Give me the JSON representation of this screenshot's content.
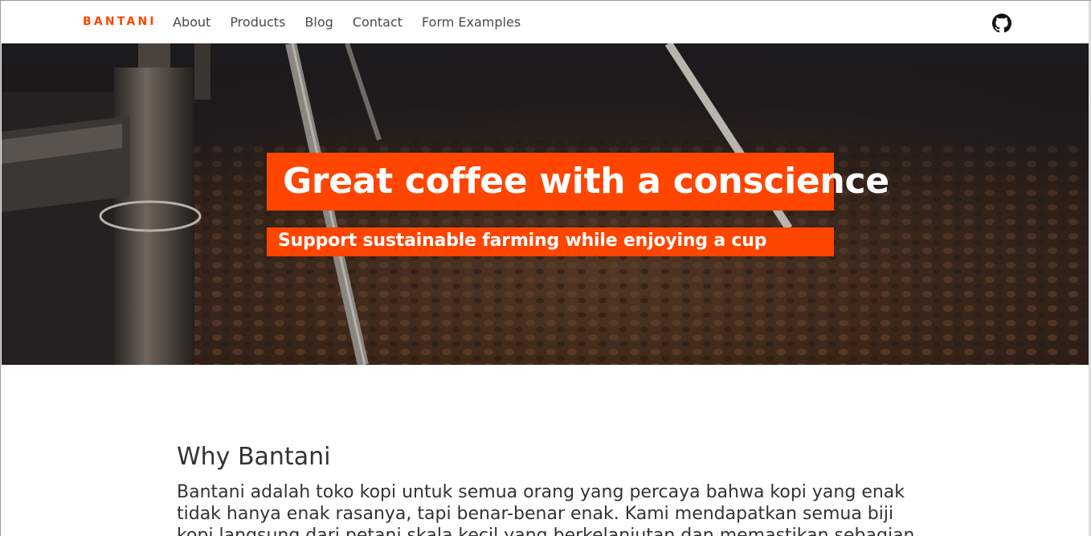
{
  "navbar": {
    "brand": "BANTANI",
    "links": [
      "About",
      "Products",
      "Blog",
      "Contact",
      "Form Examples"
    ]
  },
  "hero": {
    "title": "Great coffee with a conscience",
    "subtitle": "Support sustainable farming while enjoying a cup"
  },
  "why": {
    "title": "Why Bantani",
    "text": "Bantani adalah toko kopi untuk semua orang yang percaya bahwa kopi yang enak tidak hanya enak rasanya, tapi benar-benar enak. Kami mendapatkan semua biji kopi langsung dari petani skala kecil yang berkelanjutan dan memastikan sebagian"
  },
  "colors": {
    "accent": "#ff4500",
    "text": "#333333"
  },
  "icons": {
    "github": "github-icon"
  }
}
